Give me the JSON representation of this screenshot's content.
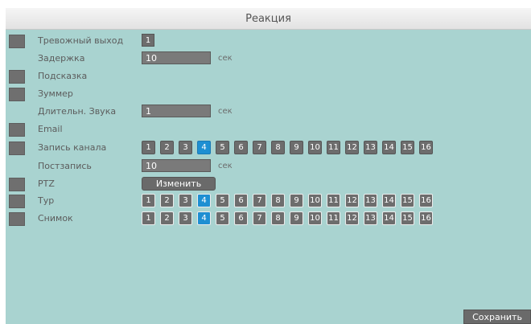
{
  "title": "Реакция",
  "alarm_out": {
    "label": "Тревожный выход",
    "value": "1"
  },
  "delay": {
    "label": "Задержка",
    "value": "10",
    "unit": "сек"
  },
  "hint": {
    "label": "Подсказка"
  },
  "buzzer": {
    "label": "Зуммер"
  },
  "sound_duration": {
    "label": "Длительн. Звука",
    "value": "1",
    "unit": "сек"
  },
  "email": {
    "label": "Email"
  },
  "channel_record": {
    "label": "Запись канала"
  },
  "post_record": {
    "label": "Постзапись",
    "value": "10",
    "unit": "сек"
  },
  "ptz": {
    "label": "PTZ",
    "button": "Изменить"
  },
  "tour": {
    "label": "Тур"
  },
  "snapshot": {
    "label": "Снимок"
  },
  "channels": [
    "1",
    "2",
    "3",
    "4",
    "5",
    "6",
    "7",
    "8",
    "9",
    "10",
    "11",
    "12",
    "13",
    "14",
    "15",
    "16"
  ],
  "selected_channel": "4",
  "save_button": "Сохранить"
}
